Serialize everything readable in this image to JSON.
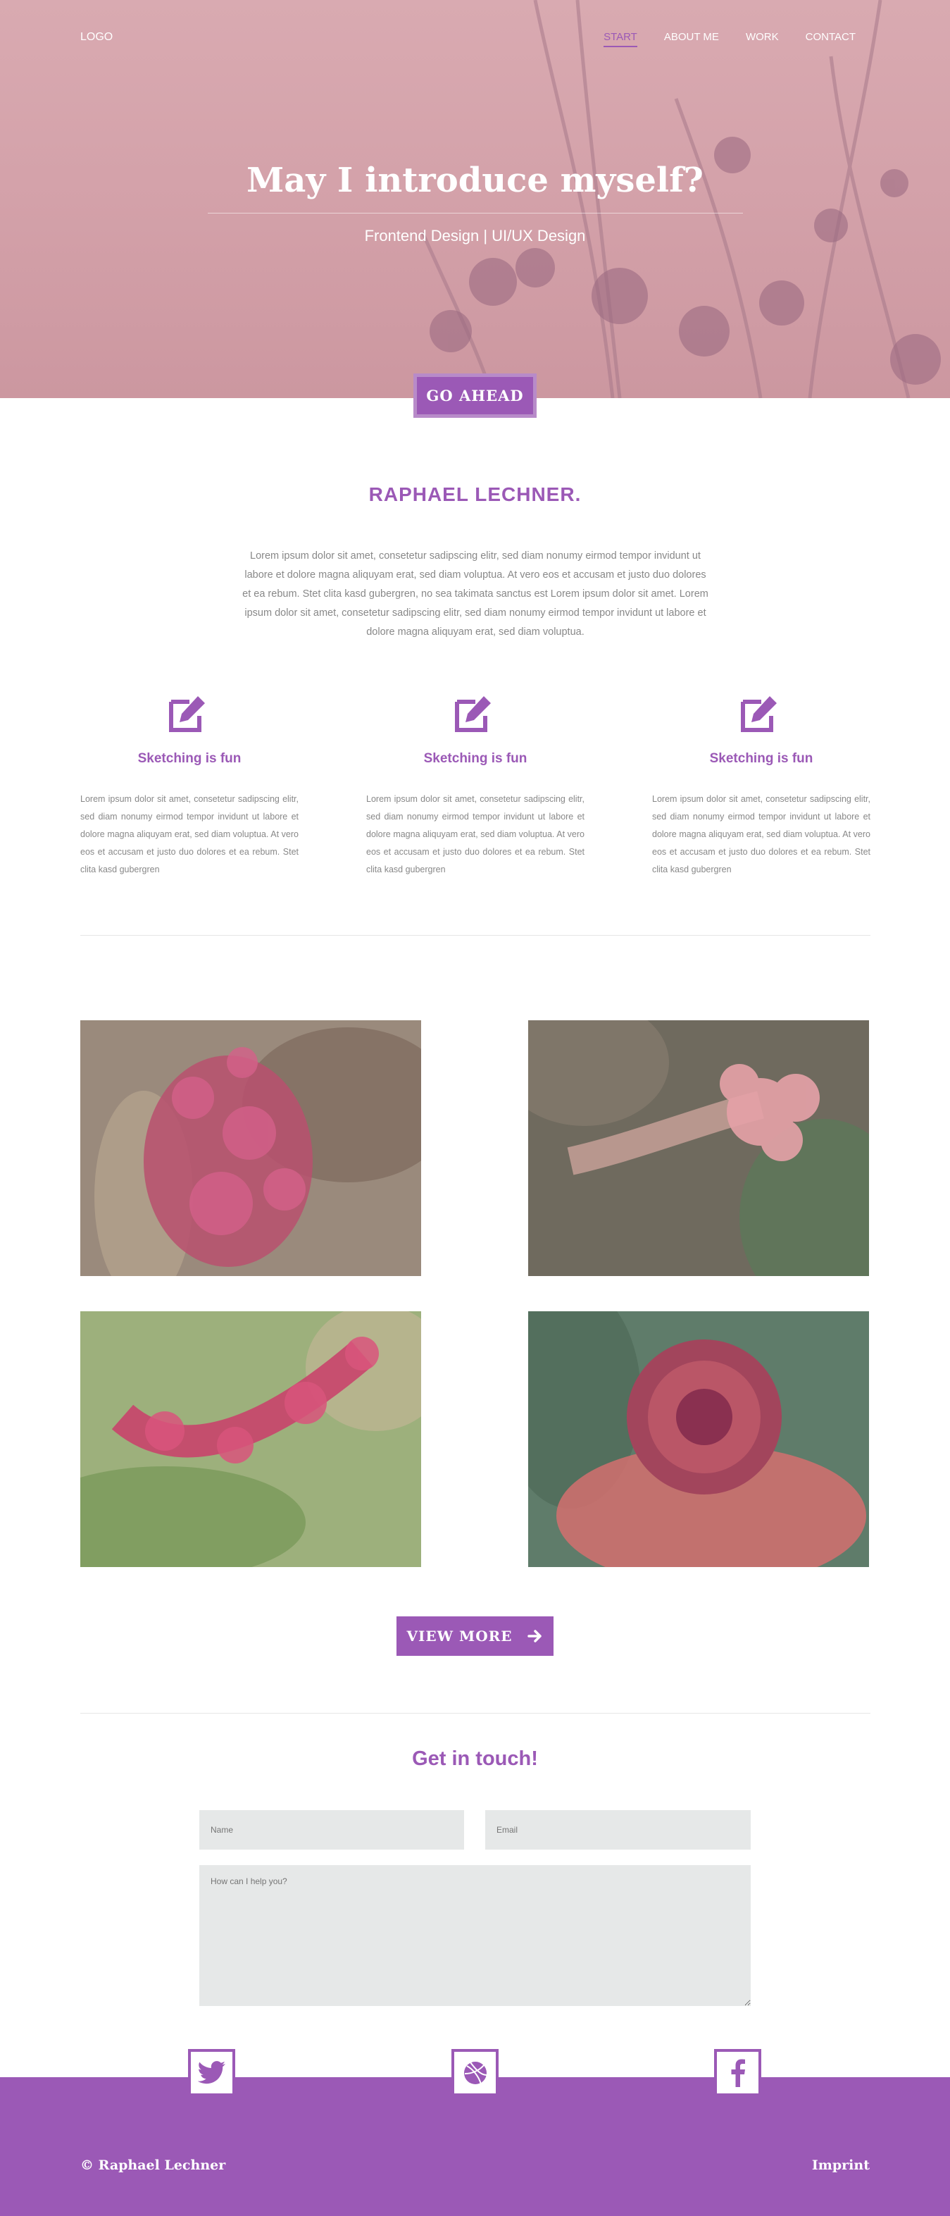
{
  "header": {
    "logo": "LOGO",
    "nav": [
      {
        "label": "START",
        "active": true
      },
      {
        "label": "ABOUT ME",
        "active": false
      },
      {
        "label": "WORK",
        "active": false
      },
      {
        "label": "CONTACT",
        "active": false
      }
    ]
  },
  "hero": {
    "title": "May I introduce myself?",
    "subtitle": "Frontend Design | UI/UX Design",
    "button": "GO AHEAD"
  },
  "about": {
    "title": "RAPHAEL LECHNER.",
    "text": "Lorem ipsum dolor sit amet, consetetur sadipscing elitr, sed diam nonumy eirmod tempor invidunt ut labore et dolore magna aliquyam erat, sed diam voluptua. At vero eos et accusam et justo duo dolores et ea rebum. Stet clita kasd gubergren, no sea takimata sanctus est Lorem ipsum dolor sit amet. Lorem ipsum dolor sit amet, consetetur sadipscing elitr, sed diam nonumy eirmod tempor invidunt ut labore et dolore magna aliquyam erat, sed diam voluptua."
  },
  "features": [
    {
      "icon": "edit-icon",
      "title": "Sketching is fun",
      "text": "Lorem ipsum dolor sit amet, consetetur sadipscing elitr, sed diam nonumy eirmod tempor invidunt ut labore et dolore magna aliquyam erat, sed diam voluptua. At vero eos et accusam et justo duo dolores et ea rebum. Stet clita kasd gubergren"
    },
    {
      "icon": "edit-icon",
      "title": "Sketching is fun",
      "text": "Lorem ipsum dolor sit amet, consetetur sadipscing elitr, sed diam nonumy eirmod tempor invidunt ut labore et dolore magna aliquyam erat, sed diam voluptua. At vero eos et accusam et justo duo dolores et ea rebum. Stet clita kasd gubergren"
    },
    {
      "icon": "edit-icon",
      "title": "Sketching is fun",
      "text": "Lorem ipsum dolor sit amet, consetetur sadipscing elitr, sed diam nonumy eirmod tempor invidunt ut labore et dolore magna aliquyam erat, sed diam voluptua. At vero eos et accusam et justo duo dolores et ea rebum. Stet clita kasd gubergren"
    }
  ],
  "gallery": {
    "button": "VIEW MORE",
    "button_icon": "arrow-right-icon"
  },
  "contact": {
    "title": "Get in touch!",
    "name_placeholder": "Name",
    "email_placeholder": "Email",
    "message_placeholder": "How can I help you?"
  },
  "social": [
    "twitter-icon",
    "dribbble-icon",
    "facebook-icon"
  ],
  "footer": {
    "copyright": "© Raphael Lechner",
    "imprint": "Imprint"
  },
  "colors": {
    "accent": "#9b59b6",
    "hero_tint": "#d4a2aa",
    "field_bg": "#e6e8e8"
  }
}
